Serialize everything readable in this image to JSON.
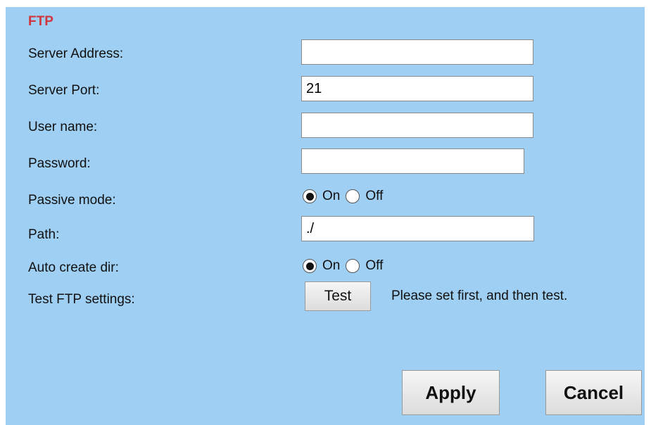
{
  "section": {
    "title": "FTP"
  },
  "fields": {
    "server_address": {
      "label": "Server Address:",
      "value": ""
    },
    "server_port": {
      "label": "Server Port:",
      "value": "21"
    },
    "user_name": {
      "label": "User name:",
      "value": ""
    },
    "password": {
      "label": "Password:",
      "value": ""
    },
    "passive_mode": {
      "label": "Passive mode:",
      "on_label": "On",
      "off_label": "Off",
      "selected": "On"
    },
    "path": {
      "label": "Path:",
      "value": "./"
    },
    "auto_create_dir": {
      "label": "Auto create dir:",
      "on_label": "On",
      "off_label": "Off",
      "selected": "On"
    },
    "test_ftp": {
      "label": "Test FTP settings:",
      "button": "Test",
      "hint": "Please set first, and then test."
    }
  },
  "actions": {
    "apply": "Apply",
    "cancel": "Cancel"
  },
  "colors": {
    "panel_bg": "#9fcff3",
    "title": "#d0373f"
  }
}
